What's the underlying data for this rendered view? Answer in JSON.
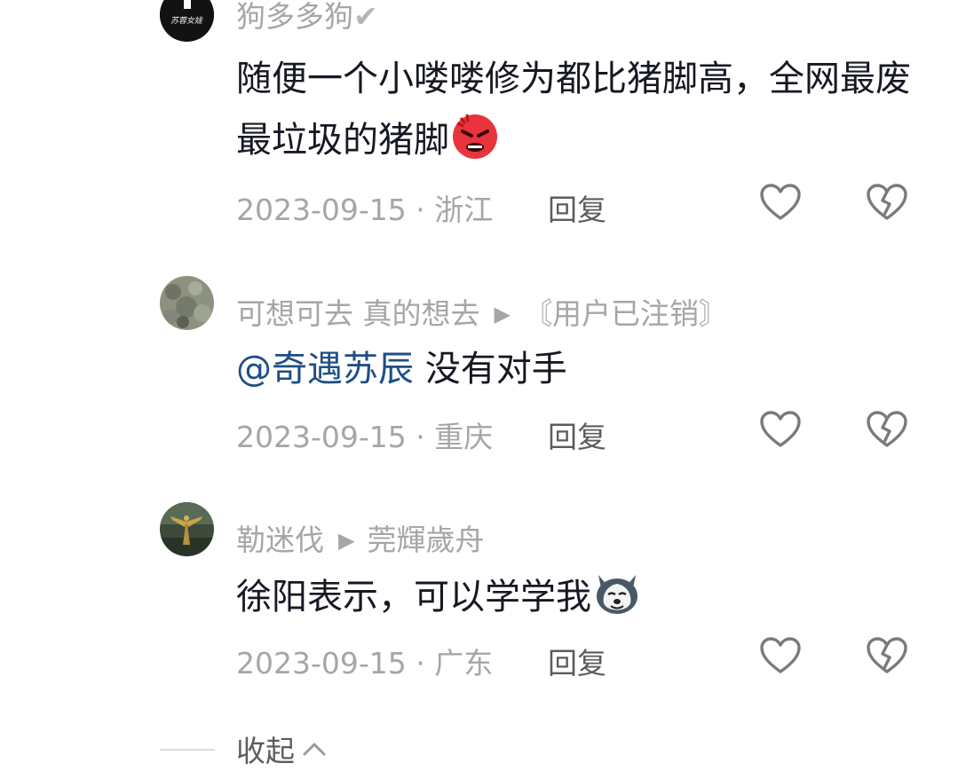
{
  "comments": [
    {
      "username": "狗多多狗",
      "verified_mark": "✔",
      "avatar_text": "苏蓉女娃",
      "text": "随便一个小喽喽修为都比猪脚高，全网最废最垃圾的猪脚",
      "emoji": "angry-face-emoji",
      "date": "2023-09-15",
      "location": "浙江",
      "reply_label": "回复"
    },
    {
      "username": "可想可去 真的想去",
      "reply_to": "〘用户已注销〙",
      "mention": "@奇遇苏辰",
      "text": " 没有对手",
      "date": "2023-09-15",
      "location": "重庆",
      "reply_label": "回复"
    },
    {
      "username": "勒迷伐",
      "reply_to": "莞輝歲舟",
      "text": "徐阳表示，可以学学我",
      "emoji": "husky-dog-emoji",
      "date": "2023-09-15",
      "location": "广东",
      "reply_label": "回复"
    }
  ],
  "meta_separator": " · ",
  "collapse_label": "收起",
  "colors": {
    "primary_text": "#161823",
    "secondary_text": "#a6a6a6",
    "mention": "#1e4e86"
  }
}
